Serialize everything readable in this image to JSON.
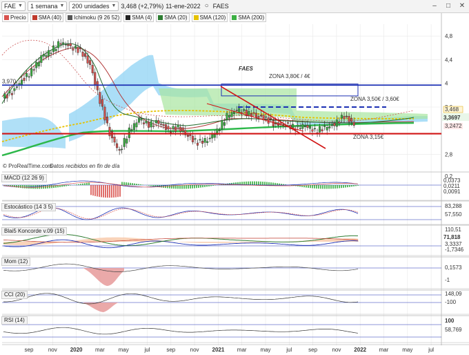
{
  "toolbar": {
    "symbol": "FAE",
    "timeframe": "1 semana",
    "units": "200 unidades",
    "price_change": "3,468 (+2,79%)",
    "date": "11-ene-2022",
    "name": "FAES"
  },
  "legend": [
    {
      "label": "Precio",
      "color": "#d9534f"
    },
    {
      "label": "SMA (40)",
      "color": "#c0392b"
    },
    {
      "label": "Ichimoku (9 26 52)",
      "color": "#555555"
    },
    {
      "label": "SMA (4)",
      "color": "#222222"
    },
    {
      "label": "SMA (20)",
      "color": "#2e7d32"
    },
    {
      "label": "SMA (120)",
      "color": "#e6c200"
    },
    {
      "label": "SMA (200)",
      "color": "#3cb043"
    }
  ],
  "panels": {
    "main": {
      "title_text": "FAES",
      "source_text": "© ProRealTime.com",
      "source_note": "Datos recibidos en fin de día",
      "level_left": "3,970",
      "y_ticks": [
        "4,8",
        "4,4",
        "4",
        "3,6",
        "2,8"
      ],
      "right_labels": [
        "3,468",
        "3,3697",
        "3,2472"
      ],
      "zones": [
        "ZONA 3,80€ / 4€",
        "ZONA 3,50€ / 3,60€",
        "ZONA 3,15€"
      ]
    },
    "macd": {
      "label": "MACD (12 26 9)",
      "tick": "0,2",
      "values": [
        "0,0373",
        "0,0211",
        "0,0091"
      ]
    },
    "stoch": {
      "label": "Estocástico (14 3 5)",
      "values": [
        "83,288",
        "57,550"
      ]
    },
    "konc": {
      "label": "Blai5 Koncorde v.09 (15)",
      "values": [
        "110,51",
        "71,818",
        "3,3337",
        "-1,7346"
      ]
    },
    "mom": {
      "label": "Mom (12)",
      "values": [
        "0,1573"
      ],
      "tick": "-1"
    },
    "cci": {
      "label": "CCI (20)",
      "values": [
        "148,09"
      ],
      "tick": "-100"
    },
    "rsi": {
      "label": "RSI (14)",
      "values": [
        "58,769"
      ],
      "tick": "100"
    }
  },
  "x_axis": [
    "sep",
    "nov",
    "2020",
    "mar",
    "may",
    "jul",
    "sep",
    "nov",
    "2021",
    "mar",
    "may",
    "jul",
    "sep",
    "nov",
    "2022",
    "mar",
    "may",
    "jul"
  ],
  "chart_data": {
    "type": "line",
    "x_axis_labels": [
      "sep",
      "nov",
      "2020",
      "mar",
      "may",
      "jul",
      "sep",
      "nov",
      "2021",
      "mar",
      "may",
      "jul",
      "sep",
      "nov",
      "2022",
      "mar",
      "may",
      "jul"
    ],
    "y_ticks": [
      4.8,
      4.4,
      4.0,
      3.6,
      2.8
    ],
    "ylim": [
      2.55,
      5.0
    ],
    "horizontal_levels": [
      {
        "value": 3.97,
        "color": "#1b2fb3"
      },
      {
        "value": 3.6,
        "color": "#1b2fb3",
        "dashed": true
      },
      {
        "value": 3.15,
        "color": "#d11414"
      }
    ],
    "price_series": [
      {
        "name": "Precio",
        "color": "#222222",
        "values": [
          3.75,
          3.85,
          4.05,
          4.2,
          4.45,
          4.55,
          4.7,
          4.62,
          4.55,
          4.3,
          3.7,
          3.15,
          2.85,
          3.2,
          3.4,
          3.3,
          3.35,
          3.2,
          3.25,
          3.1,
          3.0,
          3.05,
          3.2,
          3.45,
          3.55,
          3.5,
          3.45,
          3.4,
          3.3,
          3.3,
          3.25,
          3.3,
          3.2,
          3.25,
          3.3,
          3.45,
          3.3
        ]
      }
    ],
    "last_price": 3.468
  }
}
